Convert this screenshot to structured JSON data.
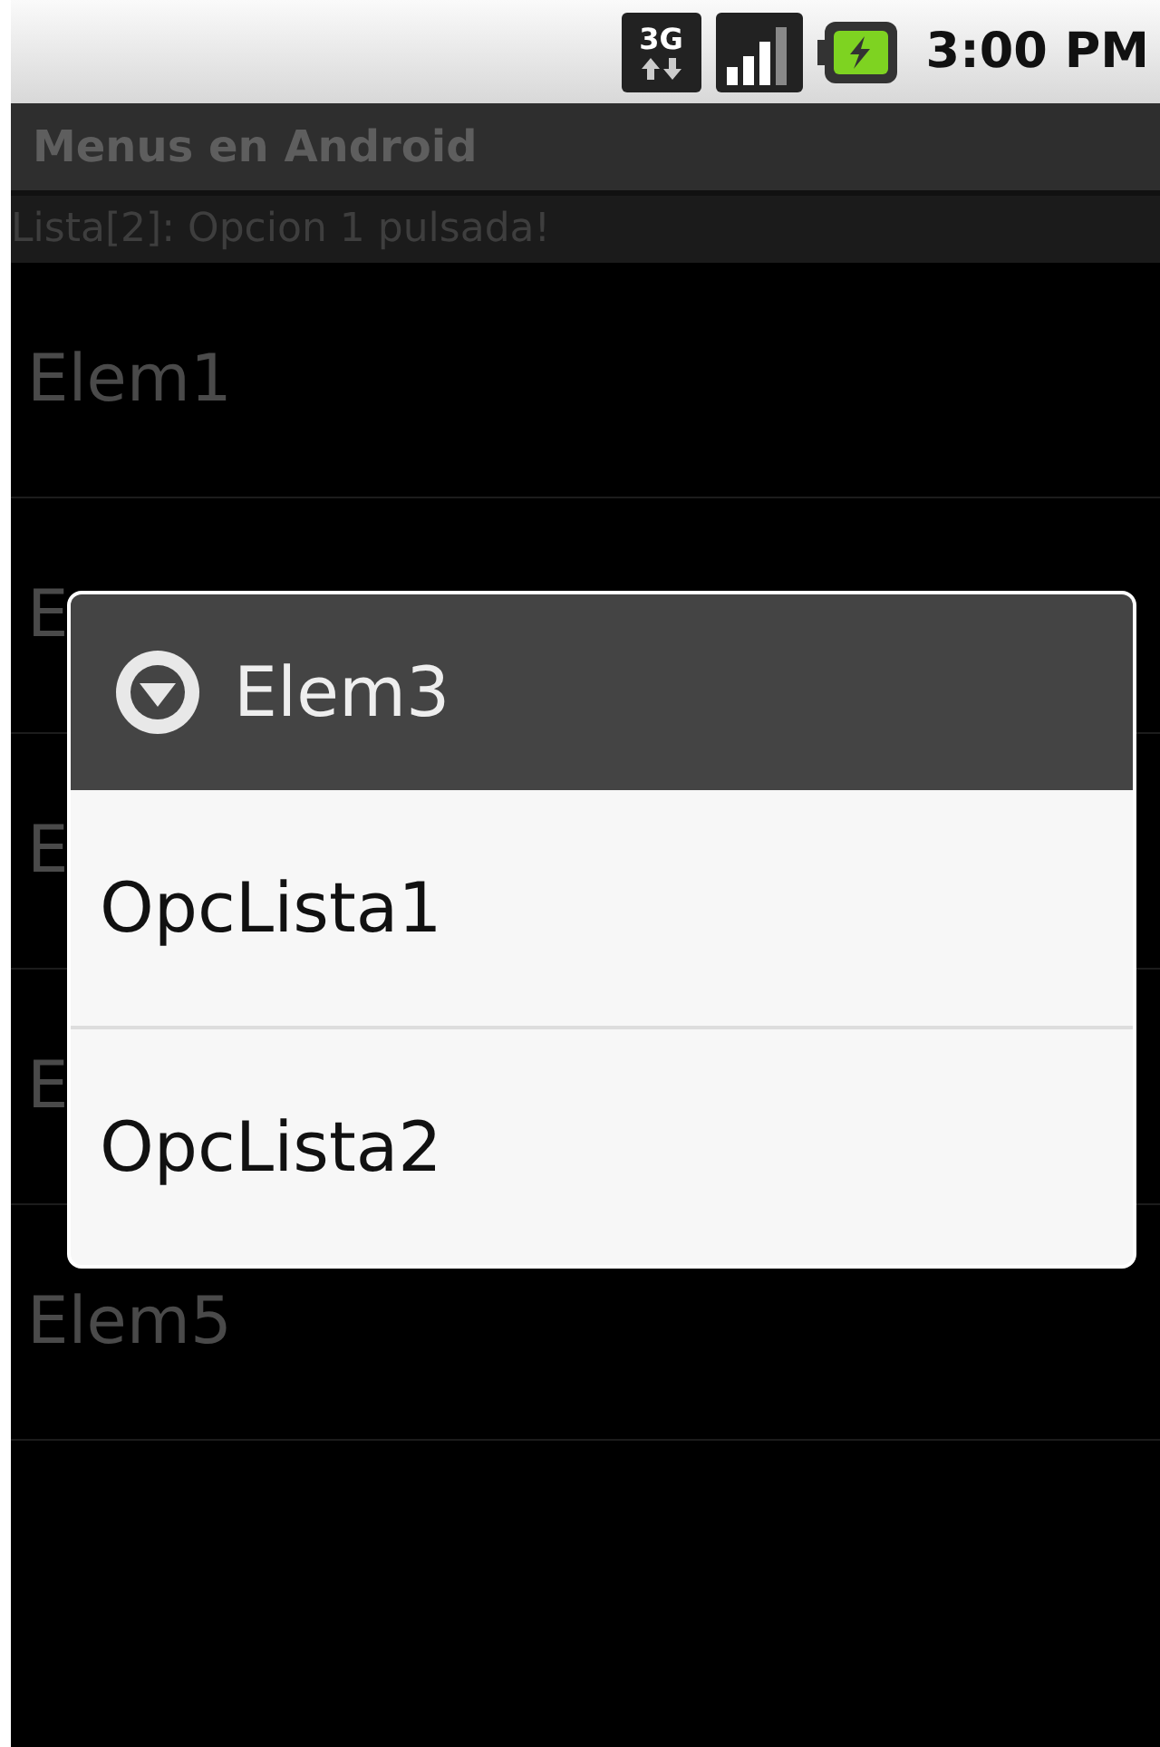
{
  "status_bar": {
    "time": "3:00 PM",
    "network": "3G"
  },
  "title_bar": {
    "title": "Menus en Android"
  },
  "message": "Lista[2]: Opcion 1 pulsada!",
  "list": {
    "items": [
      {
        "label": "Elem1"
      },
      {
        "label": "E"
      },
      {
        "label": "E"
      },
      {
        "label": "E"
      },
      {
        "label": "Elem5"
      }
    ]
  },
  "context_menu": {
    "title": "Elem3",
    "items": [
      {
        "label": "OpcLista1"
      },
      {
        "label": "OpcLista2"
      }
    ]
  }
}
